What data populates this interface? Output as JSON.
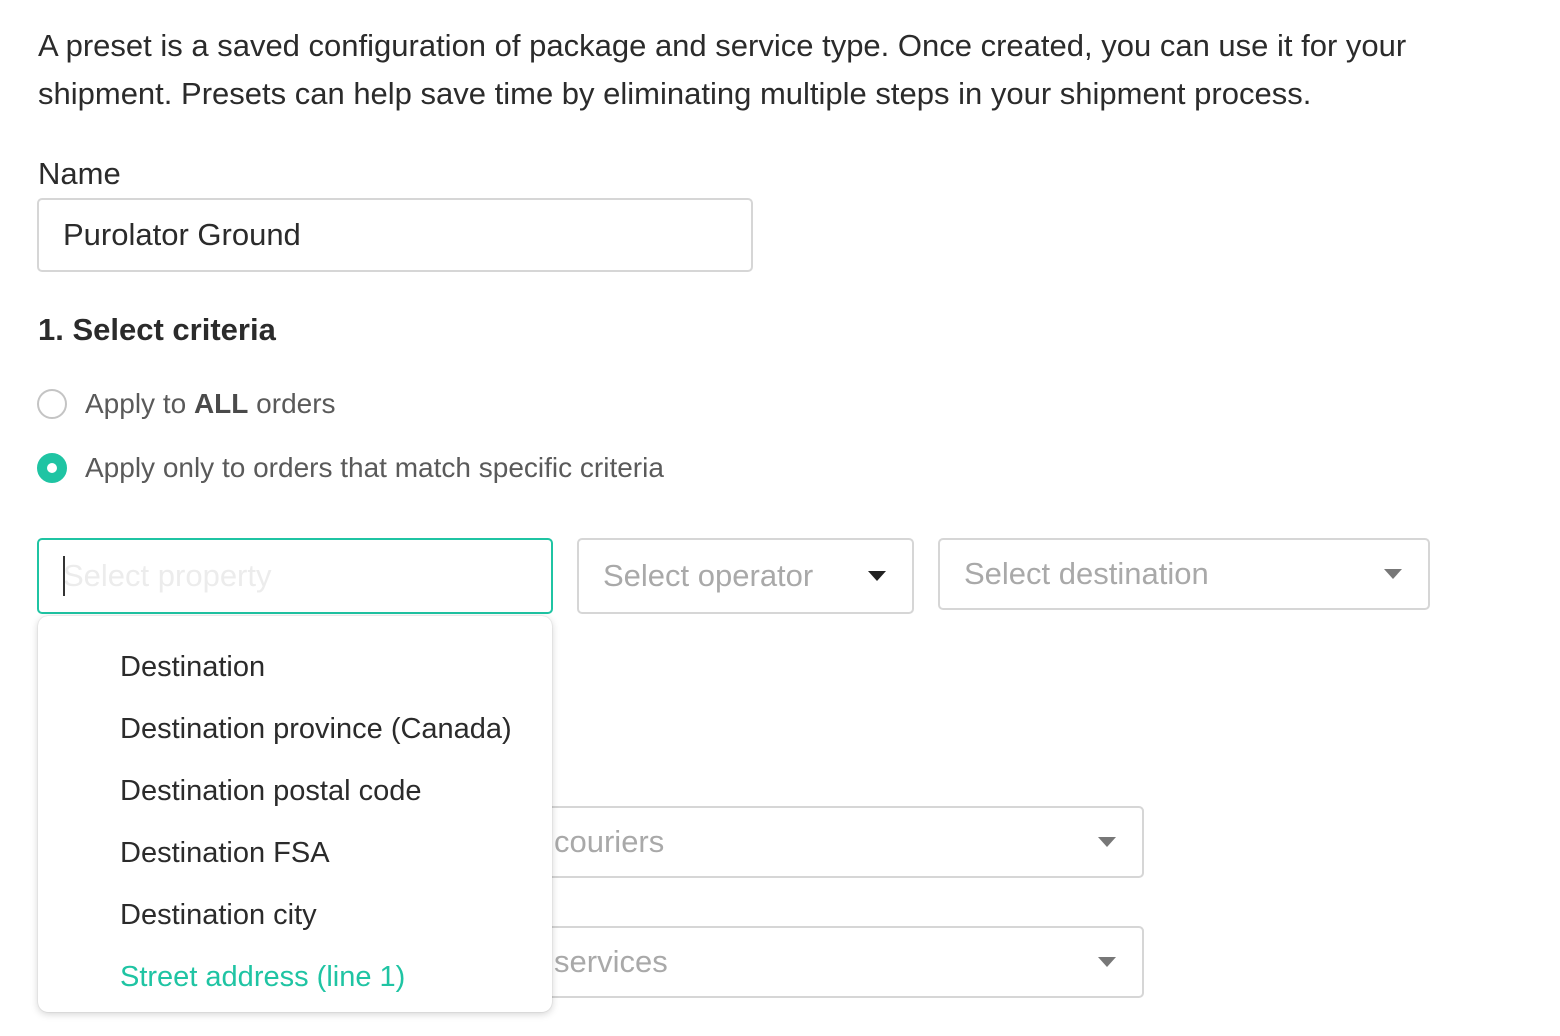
{
  "intro": "A preset is a saved configuration of package and service type. Once created, you can use it for your shipment. Presets can help save time by eliminating multiple steps in your shipment process.",
  "name_field": {
    "label": "Name",
    "value": "Purolator Ground"
  },
  "criteria": {
    "title": "1. Select criteria",
    "option_all_prefix": "Apply to ",
    "option_all_bold": "ALL",
    "option_all_suffix": " orders",
    "option_specific": "Apply only to orders that match specific criteria",
    "selected_option": "specific"
  },
  "property_select": {
    "placeholder": "Select property",
    "value": ""
  },
  "operator_select": {
    "placeholder": "Select operator"
  },
  "destination_select": {
    "placeholder": "Select destination"
  },
  "couriers_select": {
    "placeholder": "couriers"
  },
  "services_select": {
    "placeholder": "services"
  },
  "property_options": [
    {
      "label": "Destination"
    },
    {
      "label": "Destination province (Canada)"
    },
    {
      "label": "Destination postal code"
    },
    {
      "label": "Destination FSA"
    },
    {
      "label": "Destination city"
    },
    {
      "label": "Street address (line 1)"
    }
  ],
  "highlighted_option_index": 5,
  "colors": {
    "accent": "#1fc4a3",
    "text": "#2b2b2b",
    "muted": "#a9a9a9",
    "border": "#d6d6d6"
  }
}
